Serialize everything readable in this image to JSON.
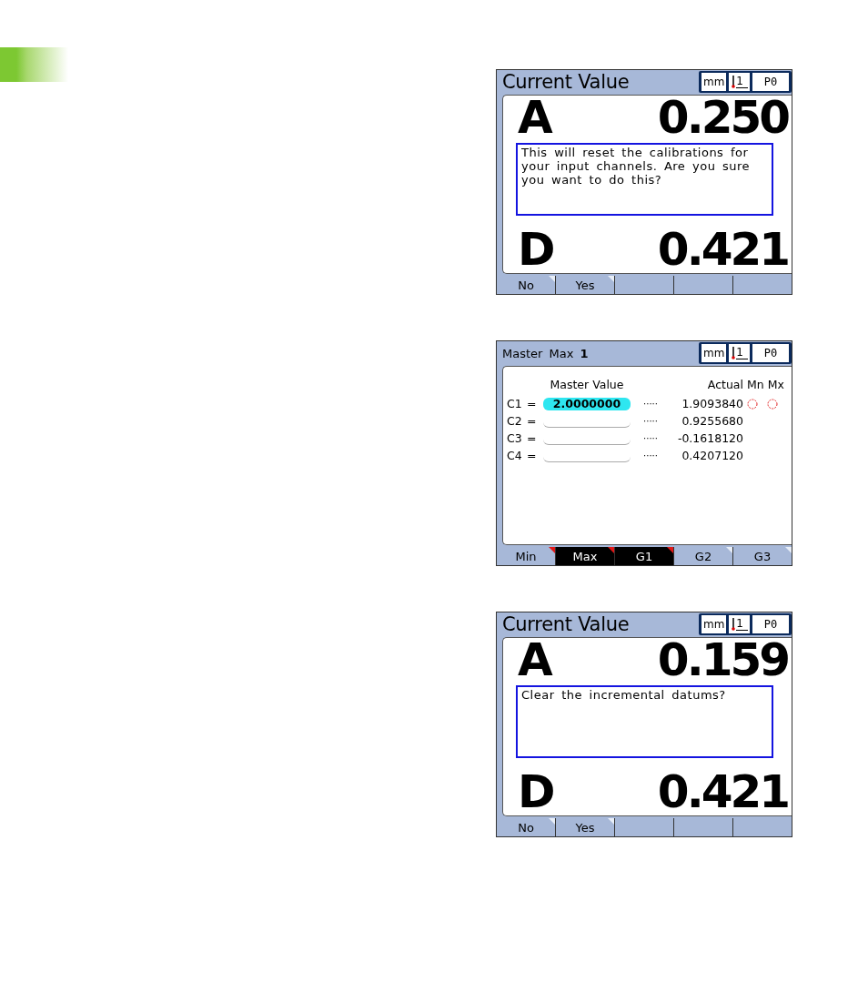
{
  "screens": [
    {
      "kind": "readout",
      "title": "Current Value",
      "status": {
        "unit": "mm",
        "axis": "1",
        "preset": "P0"
      },
      "readouts": [
        {
          "label": "A",
          "value": "0.250"
        },
        {
          "label": "D",
          "value": "0.421"
        }
      ],
      "dialog": {
        "message": "This will reset the calibrations for your input channels. Are you sure you want to do this?"
      },
      "softkeys": [
        {
          "label": "No",
          "selected": false,
          "flagged": false
        },
        {
          "label": "Yes",
          "selected": false,
          "flagged": false
        }
      ]
    },
    {
      "kind": "master",
      "title": "Master Max **1**",
      "status": {
        "unit": "mm",
        "axis": "1",
        "preset": "P0"
      },
      "table": {
        "columns": [
          "Master Value",
          "Actual",
          "Mn Mx"
        ],
        "rows": [
          {
            "channel": "C1",
            "sign": "=",
            "master": "2.0000000",
            "selected": true,
            "dots": "·····",
            "actual": "1.9093840",
            "mn_flag": true,
            "mx_flag": true
          },
          {
            "channel": "C2",
            "sign": "=",
            "selected": false,
            "dots": "·····",
            "actual": "0.9255680",
            "mn_flag": false,
            "mx_flag": false
          },
          {
            "channel": "C3",
            "sign": "=",
            "selected": false,
            "dots": "·····",
            "actual": "-0.1618120",
            "mn_flag": false,
            "mx_flag": false
          },
          {
            "channel": "C4",
            "sign": "=",
            "selected": false,
            "dots": "·····",
            "actual": "0.4207120",
            "mn_flag": false,
            "mx_flag": false
          }
        ]
      },
      "softkeys": [
        {
          "label": "Min",
          "selected": false,
          "flagged": true
        },
        {
          "label": "Max",
          "selected": true,
          "flagged": true
        },
        {
          "label": "G1",
          "selected": true,
          "flagged": true
        },
        {
          "label": "G2",
          "selected": false,
          "flagged": false
        },
        {
          "label": "G3",
          "selected": false,
          "flagged": false
        }
      ]
    },
    {
      "kind": "readout",
      "title": "Current Value",
      "status": {
        "unit": "mm",
        "axis": "1",
        "preset": "P0"
      },
      "readouts": [
        {
          "label": "A",
          "value": "0.159"
        },
        {
          "label": "D",
          "value": "0.421"
        }
      ],
      "dialog": {
        "message": "Clear the incremental datums?"
      },
      "softkeys": [
        {
          "label": "No",
          "selected": false,
          "flagged": false
        },
        {
          "label": "Yes",
          "selected": false,
          "flagged": false
        }
      ]
    }
  ]
}
